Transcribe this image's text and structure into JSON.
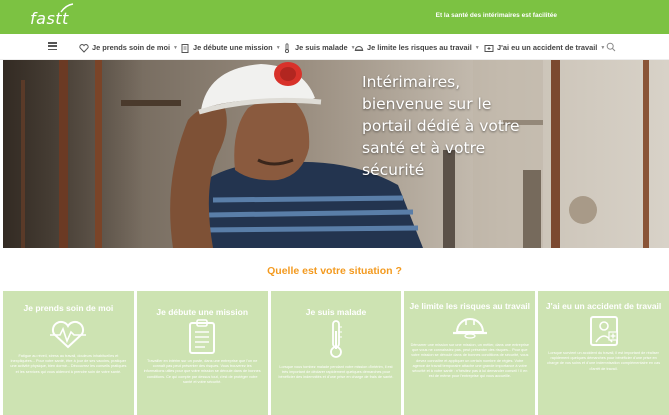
{
  "header": {
    "logo": "fastt",
    "tagline": "Et la santé des intérimaires est facilitée"
  },
  "nav": {
    "items": [
      {
        "label": "Je prends soin de moi",
        "icon": "heart-icon"
      },
      {
        "label": "Je débute une mission",
        "icon": "clipboard-icon"
      },
      {
        "label": "Je suis malade",
        "icon": "thermometer-icon"
      },
      {
        "label": "Je limite les risques au travail",
        "icon": "helmet-icon"
      },
      {
        "label": "J'ai eu un accident de travail",
        "icon": "first-aid-icon"
      }
    ]
  },
  "hero": {
    "title": "Intérimaires, bienvenue sur le portail dédié à votre santé et à votre sécurité"
  },
  "situation": {
    "question": "Quelle est votre situation ?",
    "cards": [
      {
        "title": "Je prends soin de moi",
        "icon": "heartbeat-icon",
        "text": "Fatigue au réveil, stress au travail, douleurs inhabituelles et inexpliquées... Pour votre santé, être à jour de ses vaccins, pratiquer une activité physique, bien dormir... Découvrez les conseils pratiques et les services qui vous aideront à prendre soin de votre santé."
      },
      {
        "title": "Je débute une mission",
        "icon": "clipboard-icon",
        "text": "Travailler en intérim sur un poste, dans une entreprise que l'on ne connaît pas peut présenter des risques. Vous trouverez les informations utiles pour que votre mission se déroule dans de bonnes conditions. Ce qui compte par dessus tout, c'est de protéger votre santé et votre sécurité."
      },
      {
        "title": "Je suis malade",
        "icon": "thermometer-icon",
        "text": "Lorsque vous tombez malade pendant votre mission d'intérim, il est très important de déclarer rapidement quelques démarches pour bénéficier des indemnités et d'une prise en charge de frais de santé."
      },
      {
        "title": "Je limite les risques au travail",
        "icon": "helmet-icon",
        "text": "Démarrer une mission sur une mission, un métier, dans une entreprise que vous ne connaissiez pas, peut présenter des risques... Pour que votre mission se déroule dans de bonnes conditions de sécurité, vous devez connaître et appliquer un certain nombre de règles. Votre agence de travail temporaire attache une grande importance à votre sécurité et à votre santé : n'hésitez pas à lui demander conseil ! Il en est de même pour l'entreprise qui vous accueille."
      },
      {
        "title": "J'ai eu un accident de travail",
        "icon": "first-aid-icon",
        "text": "Lorsque survient un accident du travail, il est important de réaliser rapidement quelques démarches pour bénéficier d'une prise en charge de vos soins et d'une indemnisation complémentaire en cas d'arrêt de travail."
      }
    ]
  },
  "colors": {
    "brand_green": "#7cc242",
    "card_green": "#cde3b2",
    "accent_orange": "#f39a1f"
  }
}
